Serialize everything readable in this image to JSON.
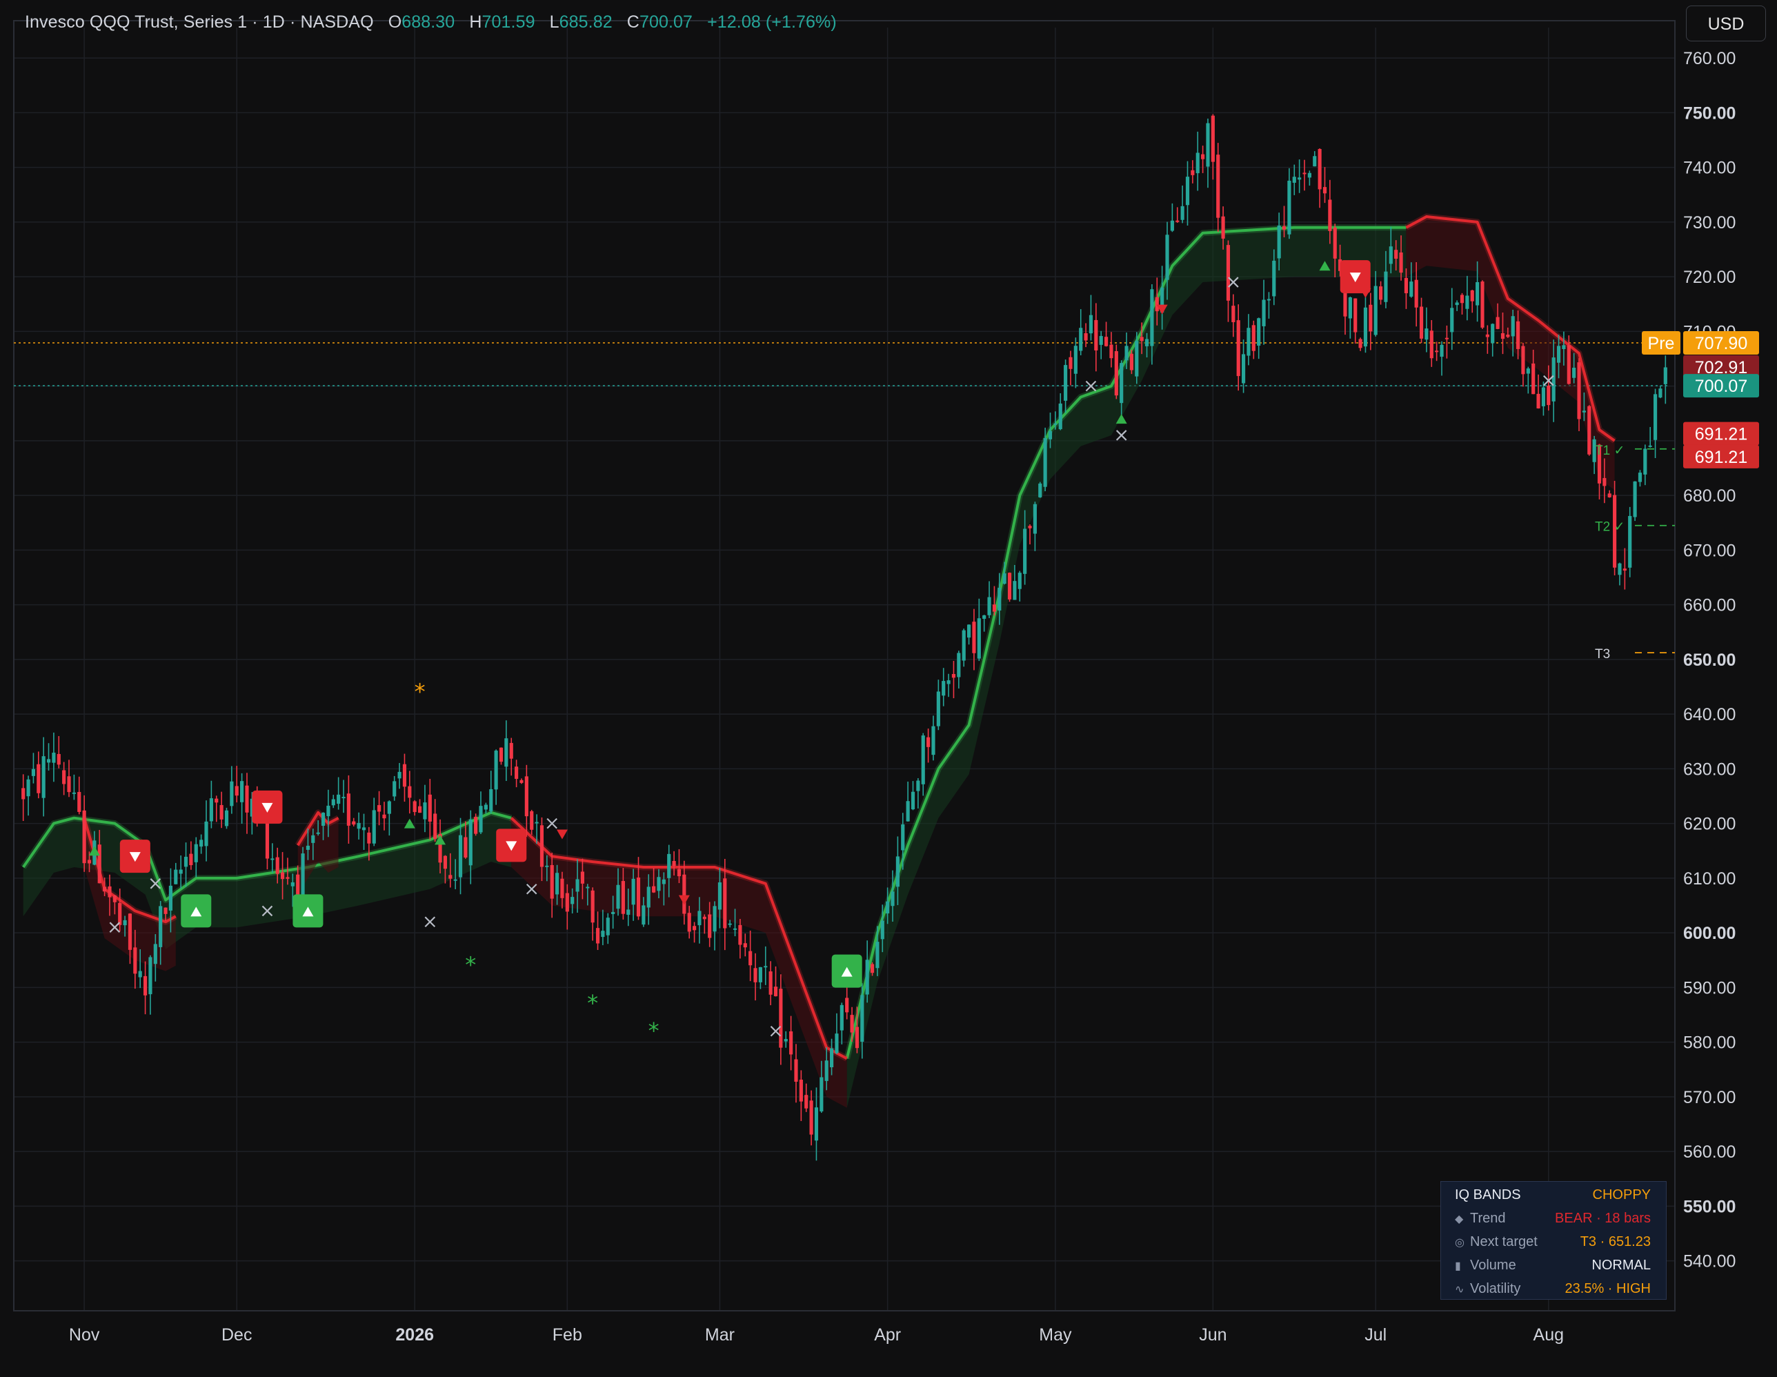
{
  "header": {
    "symbol": "Invesco QQQ Trust, Series 1 · 1D · NASDAQ",
    "o_label": "O",
    "o_value": "688.30",
    "h_label": "H",
    "h_value": "701.59",
    "l_label": "L",
    "l_value": "685.82",
    "c_label": "C",
    "c_value": "700.07",
    "change": "+12.08 (+1.76%)"
  },
  "currency_button": "USD",
  "price_tags": {
    "pre_label": "Pre",
    "pre_value": "707.90",
    "tag_red": "702.91",
    "last_price": "700.07",
    "tag_low_1": "691.21",
    "tag_low_2": "691.21"
  },
  "targets": {
    "t1": "T1 ✓",
    "t2": "T2 ✓",
    "t3": "T3"
  },
  "iq_panel": {
    "title": "IQ BANDS",
    "state": "CHOPPY",
    "trend_label": "Trend",
    "trend_value": "BEAR · 18 bars",
    "target_label": "Next target",
    "target_value": "T3 · 651.23",
    "volume_label": "Volume",
    "volume_value": "NORMAL",
    "volatility_label": "Volatility",
    "volatility_value": "23.5% · HIGH"
  },
  "colors": {
    "background": "#0f0f10",
    "up": "#26a69a",
    "down": "#f23645",
    "band_green": "#33b24a",
    "band_red": "#e0282e",
    "accent_orange": "#f59e0b",
    "panel_bg": "#131c2e"
  },
  "chart_data": {
    "type": "candlestick",
    "y_ticks": [
      "760.00",
      "750.00",
      "740.00",
      "730.00",
      "720.00",
      "710.00",
      "700.00",
      "690.00",
      "680.00",
      "670.00",
      "660.00",
      "650.00",
      "640.00",
      "630.00",
      "620.00",
      "610.00",
      "600.00",
      "590.00",
      "580.00",
      "570.00",
      "560.00",
      "550.00",
      "540.00"
    ],
    "y_ticks_bold": [
      "750.00",
      "650.00",
      "600.00",
      "550.00"
    ],
    "x_labels": [
      "Nov",
      "Dec",
      "2026",
      "Feb",
      "Mar",
      "Apr",
      "May",
      "Jun",
      "Jul",
      "Aug"
    ],
    "x_labels_bold": [
      "2026"
    ],
    "ylim": [
      535,
      770
    ],
    "key_path": [
      [
        0,
        626
      ],
      [
        3,
        628
      ],
      [
        6,
        634
      ],
      [
        9,
        626
      ],
      [
        12,
        616
      ],
      [
        15,
        612
      ],
      [
        18,
        604
      ],
      [
        21,
        596
      ],
      [
        24,
        588
      ],
      [
        26,
        600
      ],
      [
        29,
        606
      ],
      [
        32,
        614
      ],
      [
        35,
        618
      ],
      [
        38,
        624
      ],
      [
        41,
        626
      ],
      [
        44,
        624
      ],
      [
        47,
        620
      ],
      [
        50,
        612
      ],
      [
        53,
        610
      ],
      [
        56,
        612
      ],
      [
        59,
        620
      ],
      [
        62,
        622
      ],
      [
        65,
        622
      ],
      [
        68,
        620
      ],
      [
        71,
        624
      ],
      [
        74,
        626
      ],
      [
        77,
        624
      ],
      [
        80,
        618
      ],
      [
        83,
        612
      ],
      [
        86,
        614
      ],
      [
        89,
        620
      ],
      [
        92,
        628
      ],
      [
        95,
        634
      ],
      [
        98,
        628
      ],
      [
        101,
        618
      ],
      [
        104,
        610
      ],
      [
        107,
        604
      ],
      [
        110,
        612
      ],
      [
        113,
        602
      ],
      [
        116,
        604
      ],
      [
        119,
        608
      ],
      [
        122,
        606
      ],
      [
        125,
        614
      ],
      [
        128,
        610
      ],
      [
        131,
        604
      ],
      [
        134,
        600
      ],
      [
        137,
        606
      ],
      [
        140,
        602
      ],
      [
        143,
        596
      ],
      [
        146,
        590
      ],
      [
        149,
        582
      ],
      [
        152,
        574
      ],
      [
        155,
        562
      ],
      [
        158,
        576
      ],
      [
        161,
        584
      ],
      [
        164,
        582
      ],
      [
        167,
        596
      ],
      [
        170,
        608
      ],
      [
        173,
        618
      ],
      [
        176,
        630
      ],
      [
        179,
        640
      ],
      [
        182,
        648
      ],
      [
        185,
        652
      ],
      [
        188,
        656
      ],
      [
        191,
        660
      ],
      [
        194,
        664
      ],
      [
        197,
        672
      ],
      [
        200,
        684
      ],
      [
        203,
        694
      ],
      [
        206,
        704
      ],
      [
        209,
        712
      ],
      [
        212,
        708
      ],
      [
        215,
        700
      ],
      [
        218,
        706
      ],
      [
        221,
        712
      ],
      [
        224,
        720
      ],
      [
        227,
        732
      ],
      [
        230,
        740
      ],
      [
        233,
        746
      ],
      [
        236,
        728
      ],
      [
        239,
        702
      ],
      [
        242,
        710
      ],
      [
        245,
        718
      ],
      [
        248,
        732
      ],
      [
        251,
        738
      ],
      [
        254,
        742
      ],
      [
        257,
        728
      ],
      [
        260,
        716
      ],
      [
        263,
        708
      ],
      [
        266,
        716
      ],
      [
        269,
        722
      ],
      [
        272,
        720
      ],
      [
        275,
        712
      ],
      [
        278,
        704
      ],
      [
        281,
        716
      ],
      [
        284,
        718
      ],
      [
        287,
        714
      ],
      [
        290,
        708
      ],
      [
        293,
        712
      ],
      [
        296,
        702
      ],
      [
        299,
        696
      ],
      [
        302,
        708
      ],
      [
        305,
        700
      ],
      [
        308,
        690
      ],
      [
        311,
        684
      ],
      [
        314,
        664
      ],
      [
        317,
        682
      ],
      [
        320,
        692
      ],
      [
        323,
        700
      ]
    ],
    "band_green_1": [
      [
        0,
        612
      ],
      [
        6,
        620
      ],
      [
        10,
        621
      ],
      [
        18,
        620
      ],
      [
        24,
        616
      ],
      [
        28,
        606
      ],
      [
        34,
        610
      ],
      [
        42,
        610
      ],
      [
        56,
        612
      ],
      [
        66,
        614
      ],
      [
        80,
        617
      ],
      [
        92,
        622
      ],
      [
        96,
        621
      ]
    ],
    "band_green_2": [
      [
        162,
        577
      ],
      [
        168,
        600
      ],
      [
        174,
        616
      ],
      [
        180,
        630
      ],
      [
        186,
        638
      ],
      [
        192,
        662
      ],
      [
        196,
        680
      ],
      [
        202,
        692
      ],
      [
        208,
        698
      ],
      [
        214,
        700
      ],
      [
        220,
        710
      ],
      [
        226,
        722
      ],
      [
        232,
        728
      ],
      [
        250,
        729
      ],
      [
        268,
        729
      ],
      [
        272,
        729
      ]
    ],
    "band_red_1": [
      [
        12,
        621
      ],
      [
        16,
        608
      ],
      [
        22,
        604
      ],
      [
        28,
        602
      ],
      [
        30,
        603
      ]
    ],
    "band_red_2": [
      [
        54,
        616
      ],
      [
        58,
        622
      ],
      [
        60,
        620
      ],
      [
        62,
        621
      ]
    ],
    "band_red_3": [
      [
        96,
        621
      ],
      [
        104,
        614
      ],
      [
        112,
        613
      ],
      [
        122,
        612
      ],
      [
        136,
        612
      ],
      [
        146,
        609
      ],
      [
        152,
        594
      ],
      [
        158,
        579
      ],
      [
        162,
        577
      ]
    ],
    "band_red_4": [
      [
        272,
        729
      ],
      [
        276,
        731
      ],
      [
        286,
        730
      ],
      [
        292,
        716
      ],
      [
        298,
        712
      ],
      [
        306,
        706
      ],
      [
        310,
        692
      ],
      [
        313,
        690
      ]
    ],
    "signals_buy_label": [
      [
        34,
        604
      ],
      [
        56,
        604
      ],
      [
        162,
        593
      ]
    ],
    "signals_sell_label": [
      [
        22,
        614
      ],
      [
        48,
        623
      ],
      [
        96,
        616
      ],
      [
        262,
        720
      ]
    ],
    "signals_x": [
      [
        18,
        601
      ],
      [
        26,
        609
      ],
      [
        48,
        604
      ],
      [
        80,
        602
      ],
      [
        100,
        608
      ],
      [
        104,
        620
      ],
      [
        148,
        582
      ],
      [
        210,
        700
      ],
      [
        216,
        691
      ],
      [
        238,
        719
      ],
      [
        300,
        701
      ]
    ],
    "signals_small_up": [
      [
        14,
        615
      ],
      [
        76,
        620
      ],
      [
        82,
        617
      ],
      [
        256,
        722
      ],
      [
        216,
        694
      ]
    ],
    "signals_small_down": [
      [
        106,
        618
      ],
      [
        130,
        606
      ],
      [
        224,
        714
      ],
      [
        264,
        717
      ]
    ],
    "signals_star": [
      [
        78,
        644
      ],
      [
        88,
        594
      ],
      [
        112,
        587
      ],
      [
        124,
        582
      ]
    ]
  }
}
